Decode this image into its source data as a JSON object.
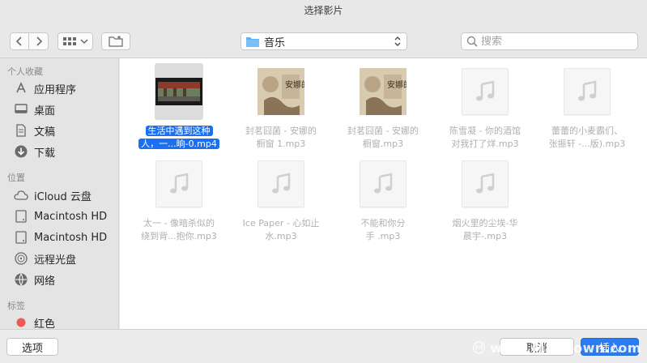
{
  "window": {
    "title": "选择影片"
  },
  "toolbar": {
    "location_label": "音乐",
    "search_placeholder": "搜索"
  },
  "sidebar": {
    "sections": [
      {
        "header": "个人收藏",
        "items": [
          {
            "label": "应用程序",
            "icon": "applications-icon"
          },
          {
            "label": "桌面",
            "icon": "desktop-icon"
          },
          {
            "label": "文稿",
            "icon": "documents-icon"
          },
          {
            "label": "下载",
            "icon": "downloads-icon"
          }
        ]
      },
      {
        "header": "位置",
        "items": [
          {
            "label": "iCloud 云盘",
            "icon": "icloud-icon"
          },
          {
            "label": "Macintosh HD",
            "icon": "hard-drive-icon"
          },
          {
            "label": "Macintosh HD",
            "icon": "hard-drive-icon"
          },
          {
            "label": "远程光盘",
            "icon": "remote-disc-icon"
          },
          {
            "label": "网络",
            "icon": "network-icon"
          }
        ]
      },
      {
        "header": "标签",
        "items": [
          {
            "label": "红色",
            "icon": "red-tag-icon"
          }
        ]
      }
    ]
  },
  "files": [
    {
      "line1": "生活中遇到这种",
      "line2": "人，一...晌-0.mp4",
      "thumb": "video",
      "selected": true
    },
    {
      "line1": "封茗囧菌 - 安娜的",
      "line2": "橱窗 1.mp3",
      "thumb": "album"
    },
    {
      "line1": "封茗囧菌 - 安娜的",
      "line2": "橱窗.mp3",
      "thumb": "album"
    },
    {
      "line1": "陈雪凝 - 你的酒馆",
      "line2": "对我打了烊.mp3",
      "thumb": "music"
    },
    {
      "line1": "蕾蕾的小麦霸们、",
      "line2": "张振轩 -...版).mp3",
      "thumb": "music"
    },
    {
      "line1": "太一 - 像暗杀似的",
      "line2": "绕到背...抱你.mp3",
      "thumb": "music"
    },
    {
      "line1": "Ice Paper - 心如止",
      "line2": "水.mp3",
      "thumb": "music"
    },
    {
      "line1": "不能和你分",
      "line2": "手 .mp3",
      "thumb": "music"
    },
    {
      "line1": "烟火里的尘埃-华",
      "line2": "晨宇-.mp3",
      "thumb": "music"
    }
  ],
  "album_art_text": "安娜的橱窗",
  "footer": {
    "options_label": "选项",
    "cancel_label": "取消",
    "insert_label": "插入"
  },
  "watermark": "www.MacDown.com",
  "colors": {
    "accent": "#1b6ff3",
    "insert_button": "#2a7cf3",
    "red_tag": "#ec5b56"
  }
}
